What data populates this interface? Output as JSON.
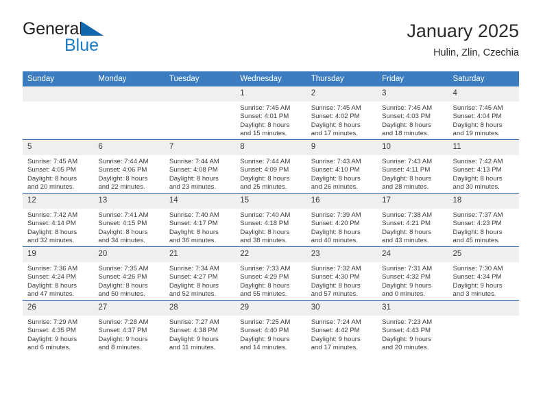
{
  "brand": {
    "name_part1": "General",
    "name_part2": "Blue",
    "logo_icon": "triangle-flag-icon",
    "colors": {
      "dark": "#231f20",
      "blue": "#1a7bc4",
      "flag": "#1266ac"
    }
  },
  "header": {
    "title": "January 2025",
    "location": "Hulin, Zlin, Czechia"
  },
  "theme": {
    "header_bar": "#3b7dc0",
    "row_divider": "#1e63a8",
    "daynum_strip": "#efefef",
    "text": "#3a3a3a"
  },
  "calendar": {
    "weekday_headers": [
      "Sunday",
      "Monday",
      "Tuesday",
      "Wednesday",
      "Thursday",
      "Friday",
      "Saturday"
    ],
    "weeks": [
      [
        {
          "day": "",
          "lines": []
        },
        {
          "day": "",
          "lines": []
        },
        {
          "day": "",
          "lines": []
        },
        {
          "day": "1",
          "lines": [
            "Sunrise: 7:45 AM",
            "Sunset: 4:01 PM",
            "Daylight: 8 hours",
            "and 15 minutes."
          ]
        },
        {
          "day": "2",
          "lines": [
            "Sunrise: 7:45 AM",
            "Sunset: 4:02 PM",
            "Daylight: 8 hours",
            "and 17 minutes."
          ]
        },
        {
          "day": "3",
          "lines": [
            "Sunrise: 7:45 AM",
            "Sunset: 4:03 PM",
            "Daylight: 8 hours",
            "and 18 minutes."
          ]
        },
        {
          "day": "4",
          "lines": [
            "Sunrise: 7:45 AM",
            "Sunset: 4:04 PM",
            "Daylight: 8 hours",
            "and 19 minutes."
          ]
        }
      ],
      [
        {
          "day": "5",
          "lines": [
            "Sunrise: 7:45 AM",
            "Sunset: 4:05 PM",
            "Daylight: 8 hours",
            "and 20 minutes."
          ]
        },
        {
          "day": "6",
          "lines": [
            "Sunrise: 7:44 AM",
            "Sunset: 4:06 PM",
            "Daylight: 8 hours",
            "and 22 minutes."
          ]
        },
        {
          "day": "7",
          "lines": [
            "Sunrise: 7:44 AM",
            "Sunset: 4:08 PM",
            "Daylight: 8 hours",
            "and 23 minutes."
          ]
        },
        {
          "day": "8",
          "lines": [
            "Sunrise: 7:44 AM",
            "Sunset: 4:09 PM",
            "Daylight: 8 hours",
            "and 25 minutes."
          ]
        },
        {
          "day": "9",
          "lines": [
            "Sunrise: 7:43 AM",
            "Sunset: 4:10 PM",
            "Daylight: 8 hours",
            "and 26 minutes."
          ]
        },
        {
          "day": "10",
          "lines": [
            "Sunrise: 7:43 AM",
            "Sunset: 4:11 PM",
            "Daylight: 8 hours",
            "and 28 minutes."
          ]
        },
        {
          "day": "11",
          "lines": [
            "Sunrise: 7:42 AM",
            "Sunset: 4:13 PM",
            "Daylight: 8 hours",
            "and 30 minutes."
          ]
        }
      ],
      [
        {
          "day": "12",
          "lines": [
            "Sunrise: 7:42 AM",
            "Sunset: 4:14 PM",
            "Daylight: 8 hours",
            "and 32 minutes."
          ]
        },
        {
          "day": "13",
          "lines": [
            "Sunrise: 7:41 AM",
            "Sunset: 4:15 PM",
            "Daylight: 8 hours",
            "and 34 minutes."
          ]
        },
        {
          "day": "14",
          "lines": [
            "Sunrise: 7:40 AM",
            "Sunset: 4:17 PM",
            "Daylight: 8 hours",
            "and 36 minutes."
          ]
        },
        {
          "day": "15",
          "lines": [
            "Sunrise: 7:40 AM",
            "Sunset: 4:18 PM",
            "Daylight: 8 hours",
            "and 38 minutes."
          ]
        },
        {
          "day": "16",
          "lines": [
            "Sunrise: 7:39 AM",
            "Sunset: 4:20 PM",
            "Daylight: 8 hours",
            "and 40 minutes."
          ]
        },
        {
          "day": "17",
          "lines": [
            "Sunrise: 7:38 AM",
            "Sunset: 4:21 PM",
            "Daylight: 8 hours",
            "and 43 minutes."
          ]
        },
        {
          "day": "18",
          "lines": [
            "Sunrise: 7:37 AM",
            "Sunset: 4:23 PM",
            "Daylight: 8 hours",
            "and 45 minutes."
          ]
        }
      ],
      [
        {
          "day": "19",
          "lines": [
            "Sunrise: 7:36 AM",
            "Sunset: 4:24 PM",
            "Daylight: 8 hours",
            "and 47 minutes."
          ]
        },
        {
          "day": "20",
          "lines": [
            "Sunrise: 7:35 AM",
            "Sunset: 4:26 PM",
            "Daylight: 8 hours",
            "and 50 minutes."
          ]
        },
        {
          "day": "21",
          "lines": [
            "Sunrise: 7:34 AM",
            "Sunset: 4:27 PM",
            "Daylight: 8 hours",
            "and 52 minutes."
          ]
        },
        {
          "day": "22",
          "lines": [
            "Sunrise: 7:33 AM",
            "Sunset: 4:29 PM",
            "Daylight: 8 hours",
            "and 55 minutes."
          ]
        },
        {
          "day": "23",
          "lines": [
            "Sunrise: 7:32 AM",
            "Sunset: 4:30 PM",
            "Daylight: 8 hours",
            "and 57 minutes."
          ]
        },
        {
          "day": "24",
          "lines": [
            "Sunrise: 7:31 AM",
            "Sunset: 4:32 PM",
            "Daylight: 9 hours",
            "and 0 minutes."
          ]
        },
        {
          "day": "25",
          "lines": [
            "Sunrise: 7:30 AM",
            "Sunset: 4:34 PM",
            "Daylight: 9 hours",
            "and 3 minutes."
          ]
        }
      ],
      [
        {
          "day": "26",
          "lines": [
            "Sunrise: 7:29 AM",
            "Sunset: 4:35 PM",
            "Daylight: 9 hours",
            "and 6 minutes."
          ]
        },
        {
          "day": "27",
          "lines": [
            "Sunrise: 7:28 AM",
            "Sunset: 4:37 PM",
            "Daylight: 9 hours",
            "and 8 minutes."
          ]
        },
        {
          "day": "28",
          "lines": [
            "Sunrise: 7:27 AM",
            "Sunset: 4:38 PM",
            "Daylight: 9 hours",
            "and 11 minutes."
          ]
        },
        {
          "day": "29",
          "lines": [
            "Sunrise: 7:25 AM",
            "Sunset: 4:40 PM",
            "Daylight: 9 hours",
            "and 14 minutes."
          ]
        },
        {
          "day": "30",
          "lines": [
            "Sunrise: 7:24 AM",
            "Sunset: 4:42 PM",
            "Daylight: 9 hours",
            "and 17 minutes."
          ]
        },
        {
          "day": "31",
          "lines": [
            "Sunrise: 7:23 AM",
            "Sunset: 4:43 PM",
            "Daylight: 9 hours",
            "and 20 minutes."
          ]
        },
        {
          "day": "",
          "lines": []
        }
      ]
    ]
  }
}
